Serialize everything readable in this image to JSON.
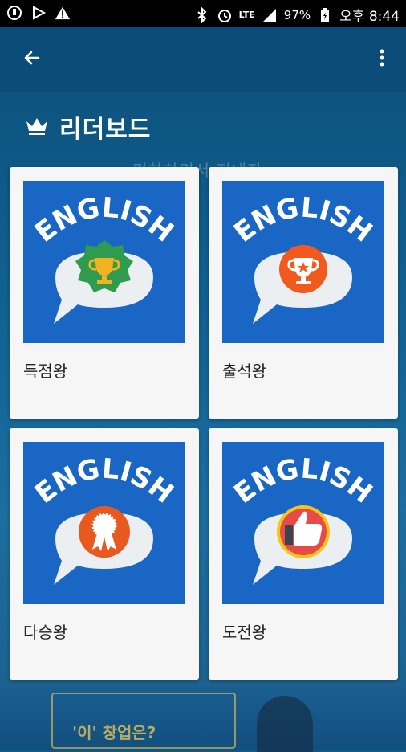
{
  "status_bar": {
    "left_icons": [
      "usb-icon",
      "play-store-icon",
      "warning-icon"
    ],
    "right_icons": [
      "bluetooth-icon",
      "alarm-icon",
      "lte-icon",
      "signal-icon",
      "battery-icon"
    ],
    "lte": "LTE",
    "battery": "97%",
    "time": "오후 8:44"
  },
  "appbar": {
    "back_icon": "back-arrow-icon",
    "menu_icon": "more-vert-icon"
  },
  "page": {
    "title": "리더보드",
    "title_icon": "crown-icon"
  },
  "background": {
    "ghost_text": "편하하면서 지내자.",
    "ghost_banner": "'이' 창업은?"
  },
  "cards": [
    {
      "label": "득점왕",
      "badge_word": "ENGLISH",
      "icon": "trophy-medal-icon",
      "badge_color": "#2e9b4f"
    },
    {
      "label": "출석왕",
      "badge_word": "ENGLISH",
      "icon": "star-trophy-icon",
      "badge_color": "#f25a1d"
    },
    {
      "label": "다승왕",
      "badge_word": "ENGLISH",
      "icon": "ribbon-award-icon",
      "badge_color": "#e8591f"
    },
    {
      "label": "도전왕",
      "badge_word": "ENGLISH",
      "icon": "thumbs-up-icon",
      "badge_color": "#e84a4a"
    }
  ],
  "colors": {
    "appbar": "#0b4d78",
    "card_image_bg": "#1a66c4"
  }
}
